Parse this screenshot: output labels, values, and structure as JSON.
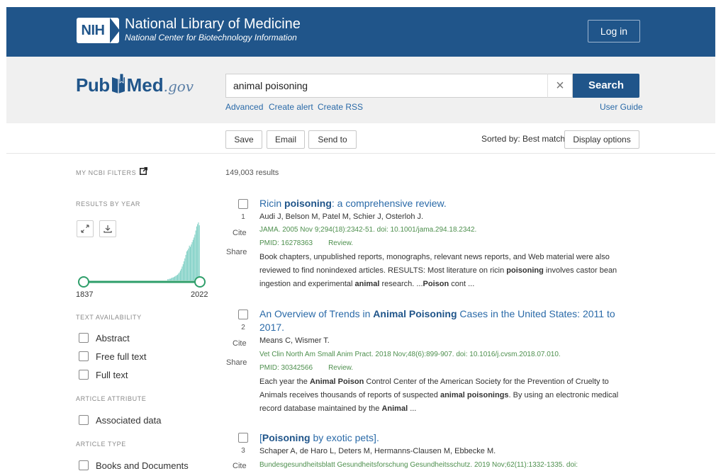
{
  "header": {
    "org_badge": "NIH",
    "org_title": "National Library of Medicine",
    "org_subtitle": "National Center for Biotechnology Information",
    "login_label": "Log in"
  },
  "brand": {
    "pub": "Pub",
    "med": "Med",
    "gov": ".gov"
  },
  "search": {
    "query": "animal poisoning",
    "clear_icon": "×",
    "button_label": "Search",
    "links": {
      "advanced": "Advanced",
      "create_alert": "Create alert",
      "create_rss": "Create RSS",
      "user_guide": "User Guide"
    }
  },
  "toolbar": {
    "save": "Save",
    "email": "Email",
    "send_to": "Send to",
    "sorted_by": "Sorted by: Best match",
    "display_options": "Display options"
  },
  "sidebar": {
    "my_filters": "MY NCBI FILTERS",
    "results_by_year": "RESULTS BY YEAR",
    "year_start": "1837",
    "year_end": "2022",
    "text_availability": "TEXT AVAILABILITY",
    "text_filters": [
      "Abstract",
      "Free full text",
      "Full text"
    ],
    "article_attribute": "ARTICLE ATTRIBUTE",
    "attribute_filters": [
      "Associated data"
    ],
    "article_type": "ARTICLE TYPE",
    "type_filters": [
      "Books and Documents"
    ]
  },
  "results": {
    "count_text": "149,003 results",
    "cite_label": "Cite",
    "share_label": "Share",
    "items": [
      {
        "num": "1",
        "title_html": "Ricin <b>poisoning</b>: a comprehensive review.",
        "authors": "Audi J, Belson M, Patel M, Schier J, Osterloh J.",
        "citation": "JAMA. 2005 Nov 9;294(18):2342-51. doi: 10.1001/jama.294.18.2342.",
        "pmid": "PMID: 16278363",
        "pubtype": "Review.",
        "snippet_html": "Book chapters, unpublished reports, monographs, relevant news reports, and Web material were also reviewed to find nonindexed articles. RESULTS: Most literature on ricin <b>poisoning</b> involves castor bean ingestion and experimental <b>animal</b> research. ...<b>Poison</b> cont ..."
      },
      {
        "num": "2",
        "title_html": "An Overview of Trends in <b>Animal Poisoning</b> Cases in the United States: 2011 to 2017.",
        "authors": "Means C, Wismer T.",
        "citation": "Vet Clin North Am Small Anim Pract. 2018 Nov;48(6):899-907. doi: 10.1016/j.cvsm.2018.07.010.",
        "pmid": "PMID: 30342566",
        "pubtype": "Review.",
        "snippet_html": "Each year the <b>Animal Poison</b> Control Center of the American Society for the Prevention of Cruelty to Animals receives thousands of reports of suspected <b>animal poisonings</b>. By using an electronic medical record database maintained by the <b>Animal</b> ..."
      },
      {
        "num": "3",
        "title_html": "[<b>Poisoning</b> by exotic pets].",
        "authors": "Schaper A, de Haro L, Deters M, Hermanns-Clausen M, Ebbecke M.",
        "citation": "Bundesgesundheitsblatt Gesundheitsforschung Gesundheitsschutz. 2019 Nov;62(11):1332-1335. doi:"
      }
    ]
  },
  "histogram": {
    "bar_color": "#7dcfc4",
    "slider_color": "#2e9e6a",
    "relative_counts": [
      0.02,
      0.02,
      0.03,
      0.03,
      0.04,
      0.05,
      0.05,
      0.06,
      0.07,
      0.08,
      0.09,
      0.1,
      0.12,
      0.14,
      0.17,
      0.2,
      0.24,
      0.28,
      0.33,
      0.38,
      0.44,
      0.5,
      0.52,
      0.55,
      0.6,
      0.58,
      0.62,
      0.66,
      0.7,
      0.74,
      0.79,
      0.86,
      0.93,
      0.97,
      1.0,
      0.95
    ]
  }
}
